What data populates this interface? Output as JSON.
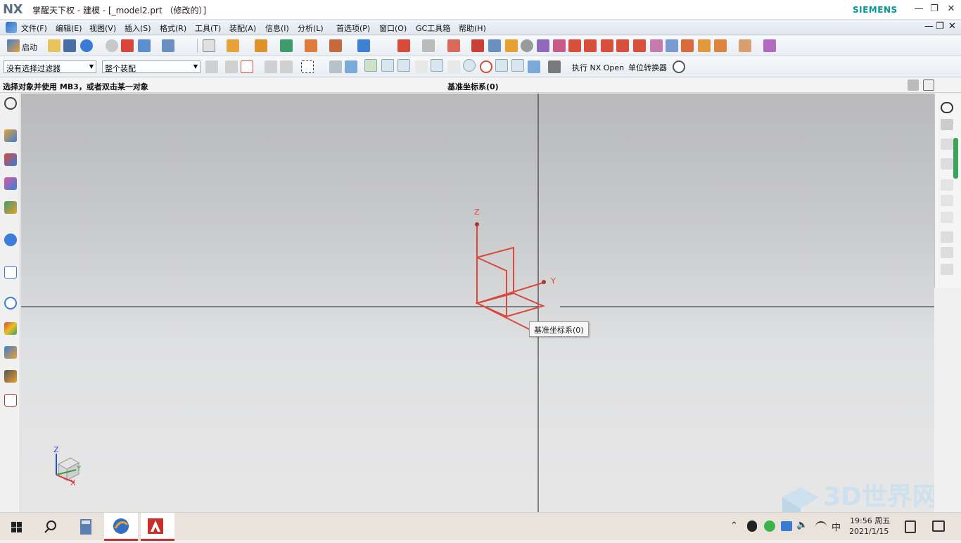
{
  "window": {
    "logo": "NX",
    "title": "掌醒天下权 - 建模 - [_model2.prt （修改的）]",
    "brand": "SIEMENS",
    "minimize": "—",
    "restore": "❐",
    "close": "✕"
  },
  "menu": {
    "items": [
      "文件(F)",
      "编辑(E)",
      "视图(V)",
      "插入(S)",
      "格式(R)",
      "工具(T)",
      "装配(A)",
      "信息(I)",
      "分析(L)",
      "首选项(P)",
      "窗口(O)",
      "GC工具箱",
      "帮助(H)"
    ],
    "doc_minimize": "—",
    "doc_restore": "❐",
    "doc_close": "✕"
  },
  "toolbar": {
    "start_label": "启动",
    "filter_value": "没有选择过滤器",
    "assembly_value": "整个装配",
    "nx_open_label": "执行 NX Open",
    "unit_converter_label": "单位转换器"
  },
  "status": {
    "prompt": "选择对象并使用 MB3，或者双击某一对象",
    "selection": "基准坐标系(0)"
  },
  "viewport": {
    "tooltip": "基准坐标系(0)",
    "axis_z": "Z",
    "axis_y": "Y",
    "triad_z": "Z",
    "triad_y": "Y",
    "triad_x": "X",
    "watermark": "3D世界网",
    "colors": {
      "csys": "#d94a3e",
      "background_top": "#b8b9bb",
      "background_bottom": "#e7e7e8"
    }
  },
  "taskbar": {
    "time": "19:56 周五",
    "date": "2021/1/15",
    "ime": "中"
  }
}
